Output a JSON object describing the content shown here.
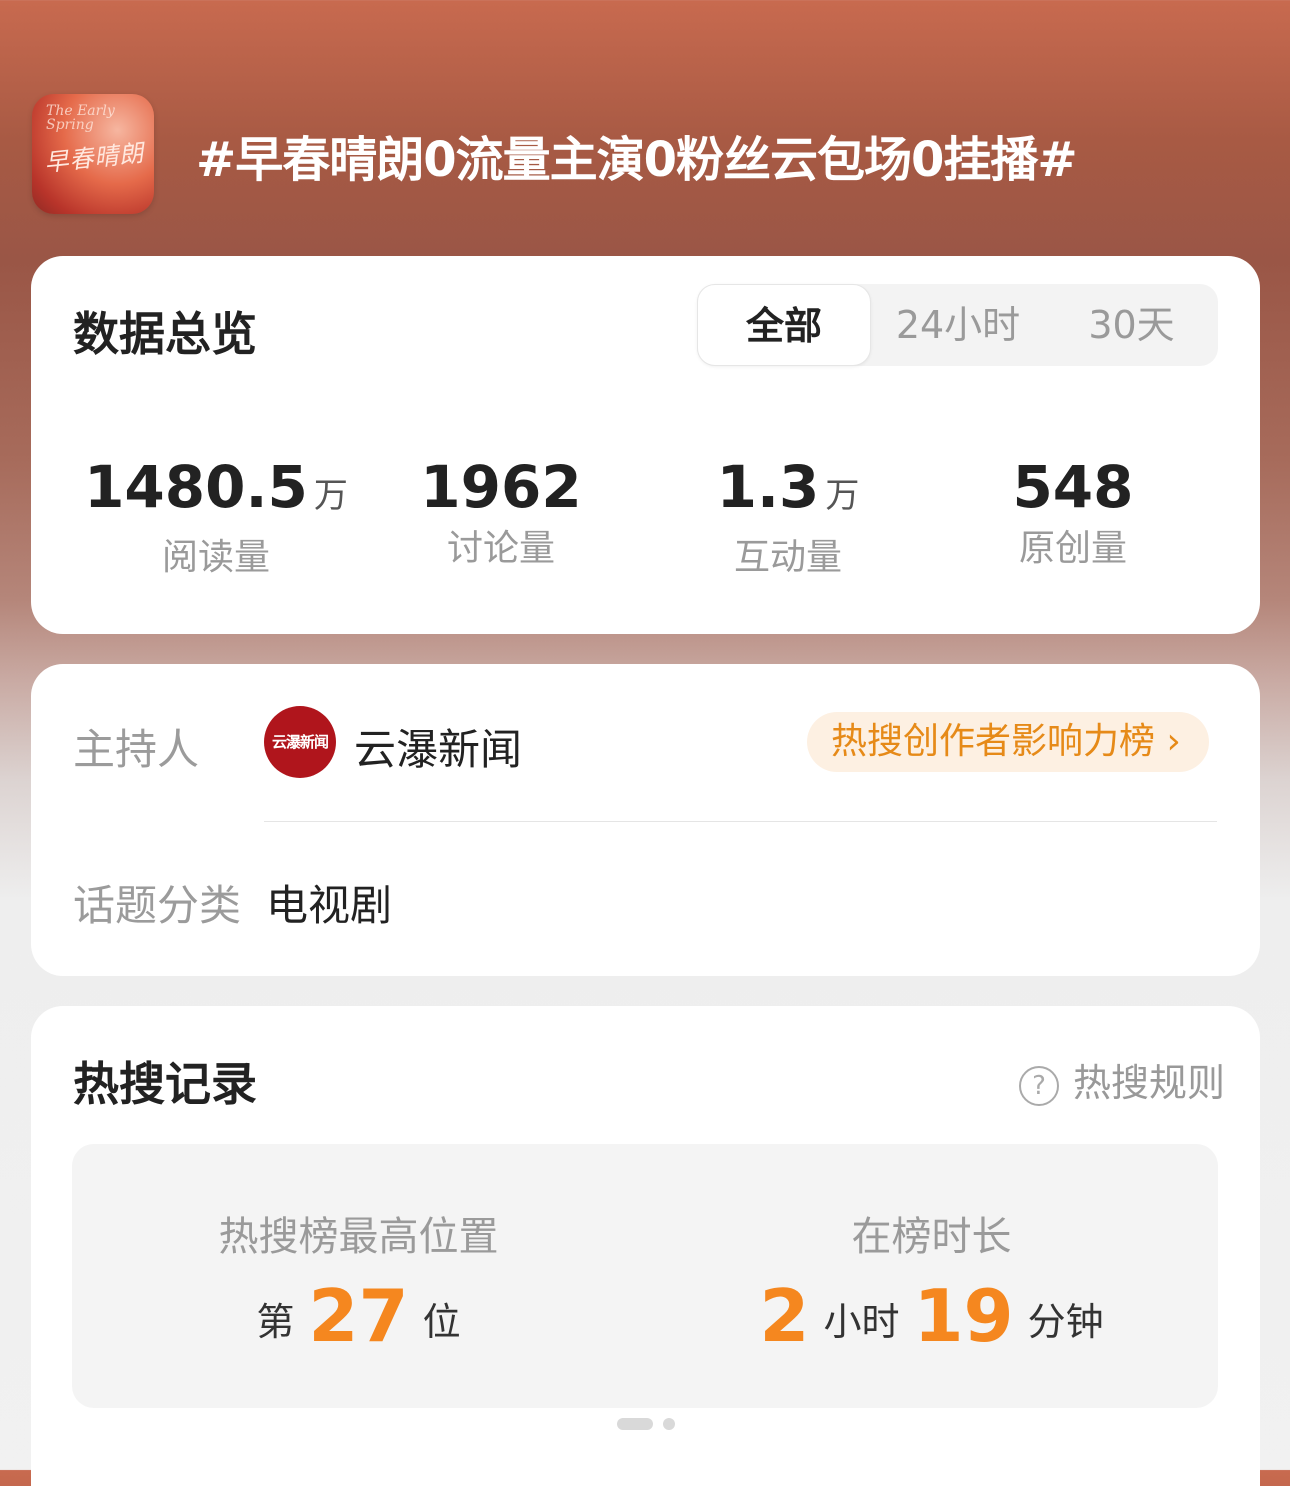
{
  "topic": {
    "cover_text": "早春晴朗",
    "cover_scribble": "The Early Spring",
    "title": "#早春晴朗0流量主演0粉丝云包场0挂播#"
  },
  "overview": {
    "title": "数据总览",
    "tabs": [
      {
        "label": "全部",
        "active": true
      },
      {
        "label": "24小时",
        "active": false
      },
      {
        "label": "30天",
        "active": false
      }
    ],
    "stats": [
      {
        "value": "1480.5",
        "unit": "万",
        "label": "阅读量"
      },
      {
        "value": "1962",
        "unit": "",
        "label": "讨论量"
      },
      {
        "value": "1.3",
        "unit": "万",
        "label": "互动量"
      },
      {
        "value": "548",
        "unit": "",
        "label": "原创量"
      }
    ]
  },
  "info": {
    "host_label": "主持人",
    "host_avatar_text": "云瀑新闻",
    "host_name": "云瀑新闻",
    "rank_link": "热搜创作者影响力榜 ›",
    "category_label": "话题分类",
    "category_value": "电视剧"
  },
  "hot": {
    "title": "热搜记录",
    "rules_label": "热搜规则",
    "peak_label": "热搜榜最高位置",
    "peak_prefix": "第",
    "peak_value": "27",
    "peak_suffix": "位",
    "duration_label": "在榜时长",
    "hours": "2",
    "hours_unit": "小时",
    "minutes": "19",
    "minutes_unit": "分钟"
  },
  "colors": {
    "accent_orange": "#f5871f",
    "rank_link_text": "#e68a18",
    "rank_link_bg": "#fdf0e2",
    "avatar_red": "#b0151c"
  }
}
